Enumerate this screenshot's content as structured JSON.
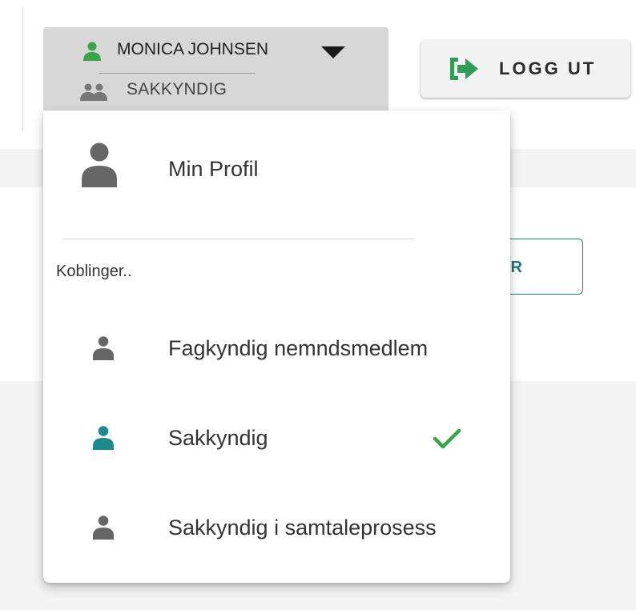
{
  "user_menu": {
    "user_name": "MONICA JOHNSEN",
    "role": "SAKKYNDIG"
  },
  "logout": {
    "label": "LOGG UT"
  },
  "background": {
    "partial_button_text": "R"
  },
  "dropdown": {
    "profile_label": "Min Profil",
    "section_heading": "Koblinger..",
    "links": [
      {
        "label": "Fagkyndig nemndsmedlem",
        "active": false
      },
      {
        "label": "Sakkyndig",
        "active": true
      },
      {
        "label": "Sakkyndig i samtaleprosess",
        "active": false
      }
    ]
  },
  "colors": {
    "user_icon_green": "#3ba44a",
    "active_icon_teal": "#1f8a8c",
    "inactive_icon_gray": "#666666",
    "check_green": "#3ba44a",
    "logout_icon_green": "#2f9d57"
  },
  "icons": {
    "user": "person-icon",
    "group": "group-icon",
    "caret": "caret-down-icon",
    "logout": "logout-icon",
    "check": "check-icon"
  }
}
